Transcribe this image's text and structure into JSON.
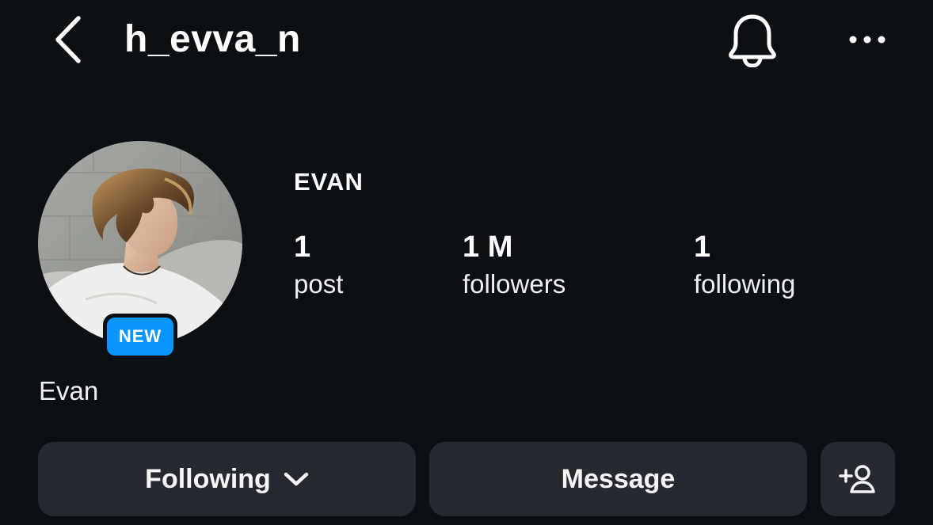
{
  "header": {
    "username": "h_evva_n",
    "back_icon": "chevron-left-icon",
    "notification_icon": "bell-icon",
    "more_icon": "more-horizontal-icon"
  },
  "profile": {
    "display_name": "EVAN",
    "bio_name": "Evan",
    "avatar_badge": "NEW",
    "badge_color": "#0a95ff",
    "stats": [
      {
        "value": "1",
        "label": "post"
      },
      {
        "value": "1 M",
        "label": "followers"
      },
      {
        "value": "1",
        "label": "following"
      }
    ]
  },
  "actions": {
    "following_label": "Following",
    "message_label": "Message",
    "add_person_icon": "add-person-icon"
  },
  "colors": {
    "background": "#0c1015",
    "button_background": "#262a30",
    "text": "#f5f5f5",
    "badge": "#0a95ff"
  }
}
